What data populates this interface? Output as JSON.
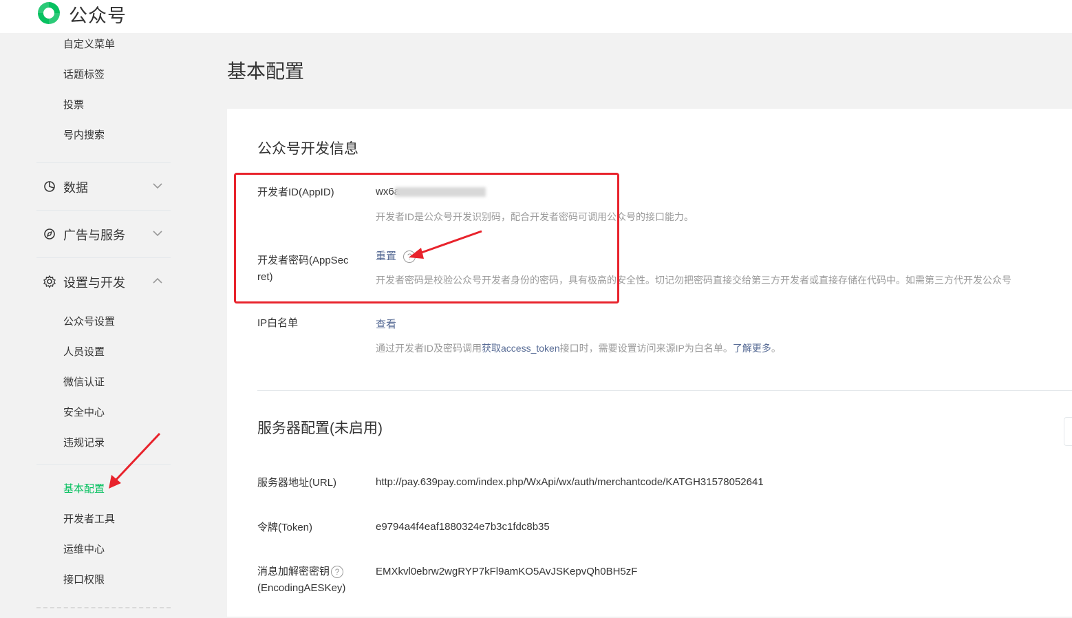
{
  "header": {
    "brand": "公众号"
  },
  "sidebar": {
    "top_items": [
      "自定义菜单",
      "话题标签",
      "投票",
      "号内搜索"
    ],
    "groups": [
      {
        "label": "数据",
        "icon": "chart-pie-icon",
        "expanded": false
      },
      {
        "label": "广告与服务",
        "icon": "compass-icon",
        "expanded": false
      },
      {
        "label": "设置与开发",
        "icon": "gear-icon",
        "expanded": true
      }
    ],
    "settings_items": [
      "公众号设置",
      "人员设置",
      "微信认证",
      "安全中心",
      "违规记录"
    ],
    "dev_items": [
      "基本配置",
      "开发者工具",
      "运维中心",
      "接口权限"
    ],
    "active_item": "基本配置"
  },
  "page": {
    "title": "基本配置"
  },
  "dev_info": {
    "title": "公众号开发信息",
    "appid_label": "开发者ID(AppID)",
    "appid_value": "wx6a",
    "appid_hint": "开发者ID是公众号开发识别码，配合开发者密码可调用公众号的接口能力。",
    "secret_label_line1": "开发者密码(AppSec",
    "secret_label_line2": "ret)",
    "secret_action": "重置",
    "secret_hint": "开发者密码是校验公众号开发者身份的密码，具有极高的安全性。切记勿把密码直接交给第三方开发者或直接存储在代码中。如需第三方代开发公众号",
    "ip_label": "IP白名单",
    "ip_action": "查看",
    "ip_hint_prefix": "通过开发者ID及密码调用",
    "ip_hint_link": "获取access_token",
    "ip_hint_suffix": "接口时，需要设置访问来源IP为白名单。",
    "ip_learn_more": "了解更多",
    "ip_hint_end": "。"
  },
  "server_config": {
    "title": "服务器配置(未启用)",
    "url_label": "服务器地址(URL)",
    "url_value": "http://pay.639pay.com/index.php/WxApi/wx/auth/merchantcode/KATGH31578052641",
    "token_label": "令牌(Token)",
    "token_value": "e9794a4f4eaf1880324e7b3c1fdc8b35",
    "aes_label_line1": "消息加解密密钥",
    "aes_label_line2": "(EncodingAESKey)",
    "aes_value": "EMXkvl0ebrw2wgRYP7kFl9amKO5AvJSKepvQh0BH5zF",
    "help_glyph": "?"
  },
  "colors": {
    "accent_green": "#07c160",
    "link_blue": "#576b95",
    "annotation_red": "#e8232c"
  }
}
